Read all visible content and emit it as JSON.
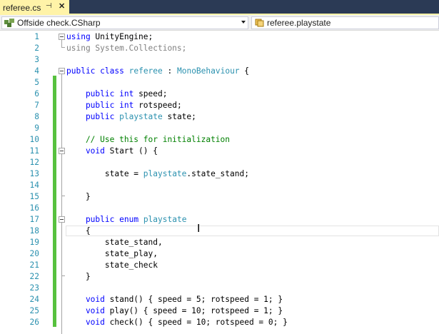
{
  "tab": {
    "title": "referee.cs",
    "pin_icon": "pin-icon",
    "close_icon": "close-icon"
  },
  "navbar": {
    "left_combo": "Offside check.CSharp",
    "right_combo": "referee.playstate"
  },
  "colors": {
    "keyword": "#0000ff",
    "type": "#2b91af",
    "comment": "#008000",
    "grayed": "#808080",
    "change_bar": "#57c13e",
    "tab_bg": "#fff3a8",
    "tabstrip_bg": "#2b3a55"
  },
  "lines": [
    {
      "n": "1",
      "segs": [
        {
          "t": "using",
          "c": "kw"
        },
        {
          "t": " UnityEngine;",
          "c": ""
        }
      ]
    },
    {
      "n": "2",
      "segs": [
        {
          "t": "using System.Collections;",
          "c": "gr"
        }
      ]
    },
    {
      "n": "3",
      "segs": []
    },
    {
      "n": "4",
      "segs": [
        {
          "t": "public",
          "c": "kw"
        },
        {
          "t": " ",
          "c": ""
        },
        {
          "t": "class",
          "c": "kw"
        },
        {
          "t": " ",
          "c": ""
        },
        {
          "t": "referee",
          "c": "ty"
        },
        {
          "t": " : ",
          "c": ""
        },
        {
          "t": "MonoBehaviour",
          "c": "ty"
        },
        {
          "t": " {",
          "c": ""
        }
      ]
    },
    {
      "n": "5",
      "segs": []
    },
    {
      "n": "6",
      "segs": [
        {
          "t": "    public",
          "c": "kw"
        },
        {
          "t": " ",
          "c": ""
        },
        {
          "t": "int",
          "c": "kw"
        },
        {
          "t": " speed;",
          "c": ""
        }
      ]
    },
    {
      "n": "7",
      "segs": [
        {
          "t": "    public",
          "c": "kw"
        },
        {
          "t": " ",
          "c": ""
        },
        {
          "t": "int",
          "c": "kw"
        },
        {
          "t": " rotspeed;",
          "c": ""
        }
      ]
    },
    {
      "n": "8",
      "segs": [
        {
          "t": "    public",
          "c": "kw"
        },
        {
          "t": " ",
          "c": ""
        },
        {
          "t": "playstate",
          "c": "ty"
        },
        {
          "t": " state;",
          "c": ""
        }
      ]
    },
    {
      "n": "9",
      "segs": []
    },
    {
      "n": "10",
      "segs": [
        {
          "t": "    // Use this for initialization",
          "c": "cm"
        }
      ]
    },
    {
      "n": "11",
      "segs": [
        {
          "t": "    void",
          "c": "kw"
        },
        {
          "t": " Start () {",
          "c": ""
        }
      ]
    },
    {
      "n": "12",
      "segs": []
    },
    {
      "n": "13",
      "segs": [
        {
          "t": "        state = ",
          "c": ""
        },
        {
          "t": "playstate",
          "c": "ty"
        },
        {
          "t": ".state_stand;",
          "c": ""
        }
      ]
    },
    {
      "n": "14",
      "segs": []
    },
    {
      "n": "15",
      "segs": [
        {
          "t": "    }",
          "c": ""
        }
      ]
    },
    {
      "n": "16",
      "segs": []
    },
    {
      "n": "17",
      "segs": [
        {
          "t": "    public",
          "c": "kw"
        },
        {
          "t": " ",
          "c": ""
        },
        {
          "t": "enum",
          "c": "kw"
        },
        {
          "t": " ",
          "c": ""
        },
        {
          "t": "playstate",
          "c": "ty"
        }
      ]
    },
    {
      "n": "18",
      "segs": [
        {
          "t": "    {",
          "c": ""
        }
      ]
    },
    {
      "n": "19",
      "segs": [
        {
          "t": "        state_stand,",
          "c": ""
        }
      ]
    },
    {
      "n": "20",
      "segs": [
        {
          "t": "        state_play,",
          "c": ""
        }
      ]
    },
    {
      "n": "21",
      "segs": [
        {
          "t": "        state_check",
          "c": ""
        }
      ]
    },
    {
      "n": "22",
      "segs": [
        {
          "t": "    }",
          "c": ""
        }
      ]
    },
    {
      "n": "23",
      "segs": []
    },
    {
      "n": "24",
      "segs": [
        {
          "t": "    void",
          "c": "kw"
        },
        {
          "t": " stand() { speed = 5; rotspeed = 1; }",
          "c": ""
        }
      ]
    },
    {
      "n": "25",
      "segs": [
        {
          "t": "    void",
          "c": "kw"
        },
        {
          "t": " play() { speed = 10; rotspeed = 1; }",
          "c": ""
        }
      ]
    },
    {
      "n": "26",
      "segs": [
        {
          "t": "    void",
          "c": "kw"
        },
        {
          "t": " check() { speed = 10; rotspeed = 0; }",
          "c": ""
        }
      ]
    }
  ]
}
